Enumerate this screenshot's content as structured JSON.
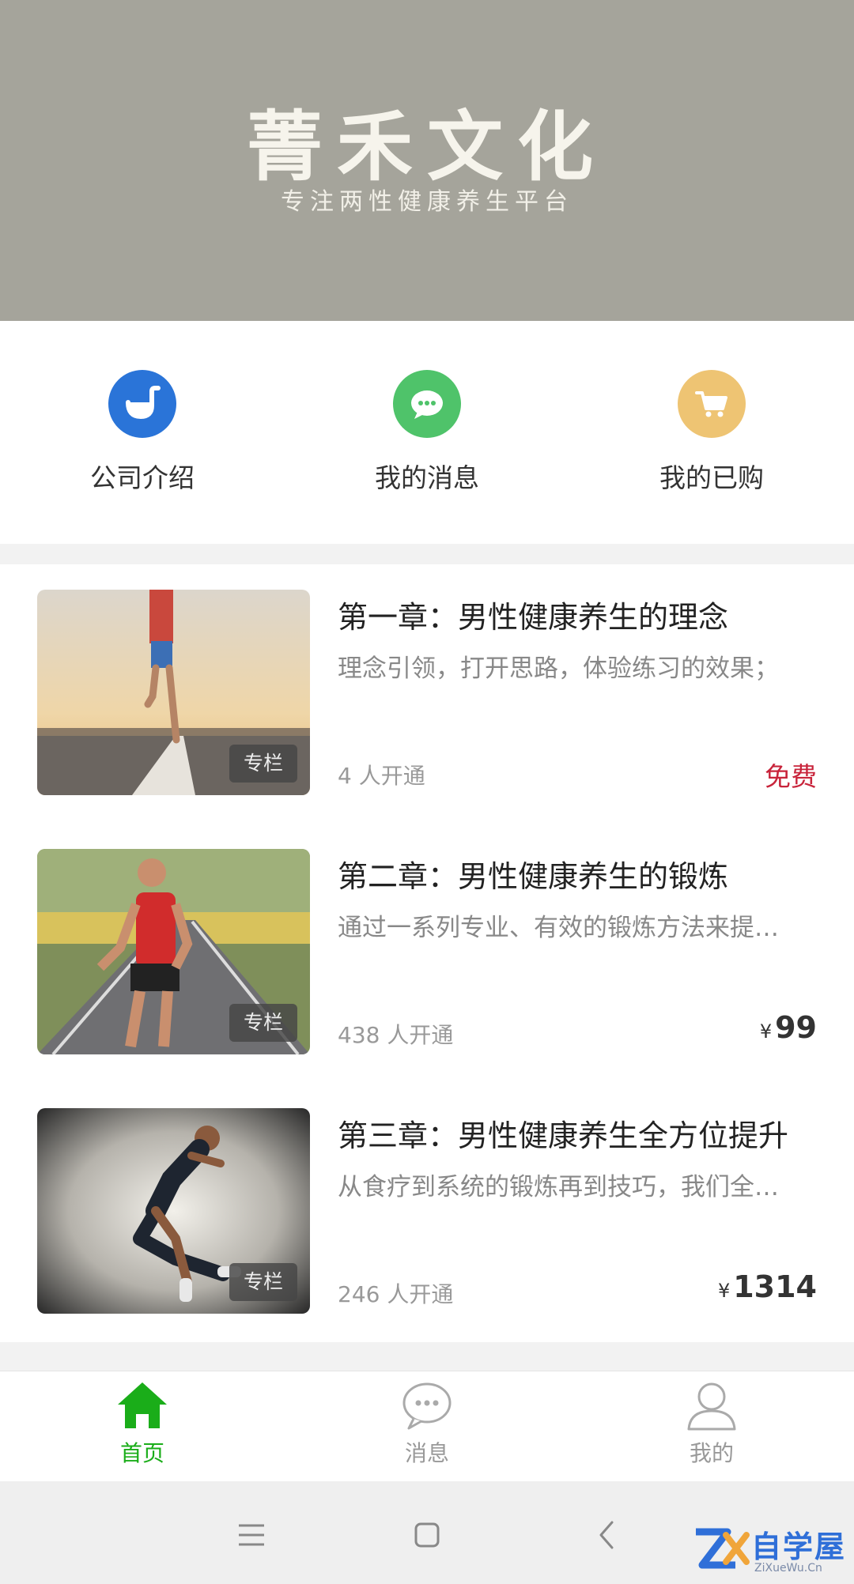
{
  "banner": {
    "title": "菁禾文化",
    "subtitle": "专注两性健康养生平台"
  },
  "quick_links": [
    {
      "label": "公司介绍",
      "icon": "company-icon",
      "color": "#2a74d8"
    },
    {
      "label": "我的消息",
      "icon": "message-icon",
      "color": "#4fc36a"
    },
    {
      "label": "我的已购",
      "icon": "cart-icon",
      "color": "#eec473"
    }
  ],
  "courses": [
    {
      "title": "第一章：男性健康养生的理念",
      "desc": "理念引领，打开思路，体验练习的效果；",
      "count": "4 人开通",
      "tag": "专栏",
      "price": "免费",
      "currency": ""
    },
    {
      "title": "第二章：男性健康养生的锻炼",
      "desc": "通过一系列专业、有效的锻炼方法来提…",
      "count": "438 人开通",
      "tag": "专栏",
      "price": "99",
      "currency": "¥"
    },
    {
      "title": "第三章：男性健康养生全方位提升",
      "desc": "从食疗到系统的锻炼再到技巧，我们全…",
      "count": "246 人开通",
      "tag": "专栏",
      "price": "1314",
      "currency": "¥"
    }
  ],
  "tabs": [
    {
      "label": "首页",
      "icon": "home-icon",
      "active": true
    },
    {
      "label": "消息",
      "icon": "chat-icon",
      "active": false
    },
    {
      "label": "我的",
      "icon": "profile-icon",
      "active": false
    }
  ],
  "watermark": {
    "text": "自学屋",
    "sub": "ZiXueWu.Cn"
  },
  "colors": {
    "accent": "#1aad19",
    "free": "#c8243b",
    "banner": "#a5a49b"
  }
}
